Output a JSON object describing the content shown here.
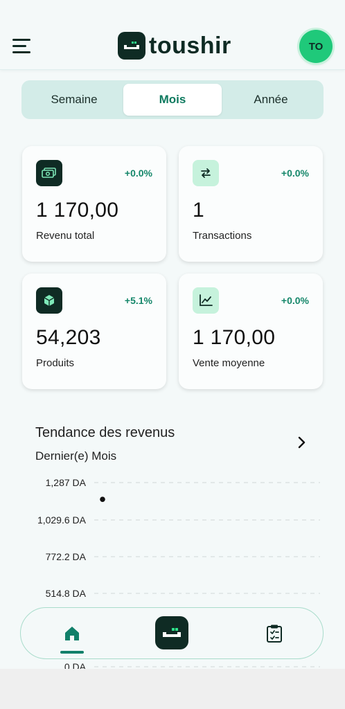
{
  "header": {
    "brand": "toushir",
    "avatar_initials": "TO"
  },
  "period_tabs": [
    {
      "label": "Semaine",
      "active": false
    },
    {
      "label": "Mois",
      "active": true
    },
    {
      "label": "Année",
      "active": false
    }
  ],
  "stats": [
    {
      "icon": "cash-icon",
      "change": "+0.0%",
      "value": "1 170,00",
      "label": "Revenu total"
    },
    {
      "icon": "transfer-arrows-icon",
      "change": "+0.0%",
      "value": "1",
      "label": "Transactions"
    },
    {
      "icon": "box-icon",
      "change": "+5.1%",
      "value": "54,203",
      "label": "Produits"
    },
    {
      "icon": "line-chart-icon",
      "change": "+0.0%",
      "value": "1 170,00",
      "label": "Vente moyenne"
    }
  ],
  "revenue_trend": {
    "title": "Tendance des revenus",
    "subtitle": "Dernier(e) Mois"
  },
  "chart_data": {
    "type": "scatter",
    "y_ticks": [
      "1,287 DA",
      "1,029.6 DA",
      "772.2 DA",
      "514.8 DA",
      "0 DA"
    ],
    "ylim": [
      0,
      1287
    ],
    "points": [
      {
        "x": 0,
        "y": 1170
      }
    ],
    "grid": true
  },
  "colors": {
    "brand_dark": "#0f2b24",
    "accent_green": "#15876a",
    "avatar_green": "#1fc97a",
    "light_mint": "#c6f2dc"
  },
  "bottom_nav": [
    {
      "icon": "home-icon",
      "active": true
    },
    {
      "icon": "toushir-logo-icon",
      "active": false
    },
    {
      "icon": "clipboard-icon",
      "active": false
    }
  ]
}
